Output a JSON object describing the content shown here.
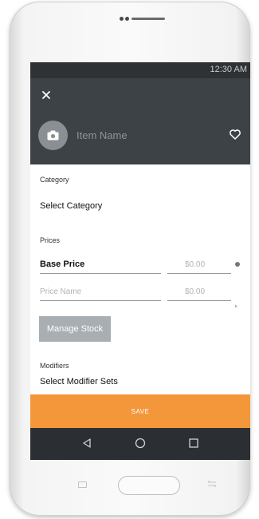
{
  "status_bar": {
    "time": "12:30 AM"
  },
  "header": {
    "close_icon": "close-icon",
    "camera_icon": "camera-icon",
    "item_name_placeholder": "Item Name",
    "favorite_icon": "heart-icon"
  },
  "category": {
    "label": "Category",
    "value": "Select Category"
  },
  "prices": {
    "label": "Prices",
    "base_price_label": "Base Price",
    "base_price_value": "$0.00",
    "price_name_placeholder": "Price Name",
    "price_name_value": "$0.00"
  },
  "manage_stock_label": "Manage Stock",
  "modifiers": {
    "label": "Modifiers",
    "value": "Select Modifier Sets"
  },
  "save_label": "SAVE",
  "nav": {
    "back": "back-icon",
    "home": "home-icon",
    "recents": "recents-icon"
  },
  "colors": {
    "header_bg": "#3d4247",
    "status_bg": "#2e3235",
    "save_accent": "#f3973a",
    "manage_stock_bg": "#a9aeb3",
    "nav_bg": "#2b2f33"
  }
}
